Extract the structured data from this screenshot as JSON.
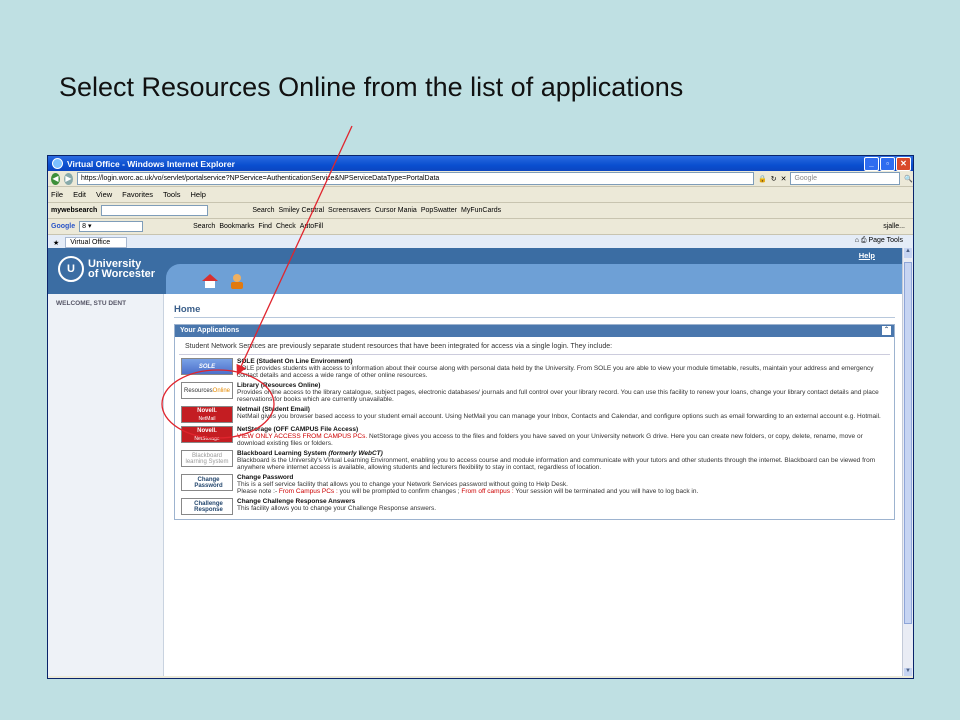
{
  "slide": {
    "title": "Select Resources Online from the list of applications"
  },
  "window": {
    "title": "Virtual Office - Windows Internet Explorer",
    "buttons": {
      "minimize": "_",
      "maximize": "▫",
      "close": "✕"
    }
  },
  "address": {
    "url": "https://login.worc.ac.uk/vo/servlet/portalservice?NPService=AuthenticationService&NPServiceDataType=PortalData",
    "search_placeholder": "Google"
  },
  "menu": [
    "File",
    "Edit",
    "View",
    "Favorites",
    "Tools",
    "Help"
  ],
  "mywebsearch": {
    "label": "mywebsearch",
    "search_label": "Search",
    "links": [
      "Smiley Central",
      "Screensavers",
      "Cursor Mania",
      "PopSwatter",
      "MyFunCards"
    ]
  },
  "google_toolbar": {
    "label": "Google",
    "search_label": "Search",
    "bookmarks": "Bookmarks",
    "find": "Find",
    "check": "Check",
    "autofill": "AutoFill",
    "user": "sjalle..."
  },
  "tabs": {
    "active": "Virtual Office",
    "page_label": "Page",
    "tools_label": "Tools"
  },
  "portal": {
    "logo_line1": "University",
    "logo_line2": "of Worcester",
    "help": "Help",
    "welcome": "WELCOME, STU DENT",
    "home": "Home",
    "apps_title": "Your Applications",
    "intro": "Student Network Services are previously separate student resources that have been integrated for access via a single login. They include:",
    "apps": [
      {
        "name": "SOLE (Student On Line Environment)",
        "icon_text": "SOLE",
        "desc": "SOLE provides students with access to information about their course along with personal data held by the University. From SOLE you are able to view your module timetable, results, maintain your address and emergency contact details and access a wide range of other online resources."
      },
      {
        "name": "Library (Resources Online)",
        "icon_text": "Resources",
        "icon_text2": "Online",
        "desc": "Provides online access to the library catalogue, subject pages, electronic databases/ journals and full control over your library record. You can use this facility to renew your loans, change your library contact details and place reservations for books which are currently unavailable."
      },
      {
        "name": "Netmail (Student Email)",
        "icon_text": "Novell.",
        "icon_text2": "NetMail",
        "desc": "NetMail gives you browser based access to your student email account. Using NetMail you can manage your Inbox, Contacts and Calendar, and configure options such as email forwarding to an external account e.g. Hotmail."
      },
      {
        "name": "NetStorage (OFF CAMPUS File Access)",
        "icon_text": "Novell.",
        "icon_text2": "NetStorage",
        "red": "VIEW ONLY ACCESS FROM CAMPUS PCs.",
        "desc": "NetStorage gives you access to the files and folders you have saved on your University network G drive. Here you can create new folders, or copy, delete, rename, move or download existing files or folders."
      },
      {
        "name": "Blackboard Learning System",
        "name_italic": "(formerly WebCT)",
        "icon_text": "Blackboard",
        "icon_text2": "learning System",
        "desc": "Blackboard is the University's Virtual Learning Environment, enabling you to access course and module information and communicate with your tutors and other students through the internet. Blackboard can be viewed from anywhere where internet access is available, allowing students and lecturers flexibility to stay in contact, regardless of location."
      },
      {
        "name": "Change Password",
        "icon_text": "Change",
        "icon_text2": "Password",
        "desc": "This is a self service facility that allows you to change your Network Services password without going to Help Desk.",
        "note_prefix": "Please note :-",
        "note_red1": "From Campus PCs :",
        "note_mid": "you will be prompted to confirm changes ;",
        "note_red2": "From off campus :",
        "note_end": "Your session will be terminated and you will have to log back in."
      },
      {
        "name": "Change Challenge Response Answers",
        "icon_text": "Challenge",
        "icon_text2": "Response",
        "desc": "This facility allows you to change your Challenge Response answers."
      }
    ]
  },
  "annotation": {
    "color": "#e0252e"
  }
}
